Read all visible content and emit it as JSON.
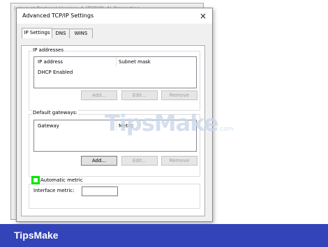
{
  "background_dialog": {
    "title": "Internet Protocol Version 4 (TCP/IPv4) Properties"
  },
  "dialog": {
    "title": "Advanced TCP/IP Settings",
    "close_icon": "×"
  },
  "tabs": [
    {
      "label": "IP Settings",
      "active": true
    },
    {
      "label": "DNS",
      "active": false
    },
    {
      "label": "WINS",
      "active": false
    }
  ],
  "ip_addresses": {
    "group_label": "IP addresses",
    "columns": [
      "IP address",
      "Subnet mask"
    ],
    "rows": [
      [
        "DHCP Enabled",
        ""
      ]
    ],
    "buttons": {
      "add": "Add...",
      "edit": "Edit...",
      "remove": "Remove"
    }
  },
  "gateways": {
    "group_label": "Default gateways:",
    "columns": [
      "Gateway",
      "Metric"
    ],
    "buttons": {
      "add": "Add...",
      "edit": "Edit...",
      "remove": "Remove"
    }
  },
  "metric": {
    "checkbox_label": "Automatic metric",
    "interface_metric_label": "Interface metric:",
    "interface_metric_value": ""
  },
  "watermark": {
    "text": "TipsMake",
    "suffix": ".com"
  },
  "footer": {
    "brand": "TipsMake"
  },
  "colors": {
    "footer_bg": "#3343b8",
    "checkbox_highlight": "#00e600",
    "watermark": "#cbd8ea"
  }
}
